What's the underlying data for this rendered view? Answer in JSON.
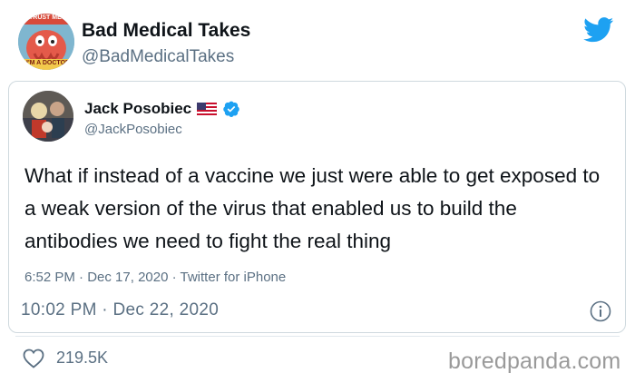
{
  "outer_tweet": {
    "avatar_text_top": "TRUST ME",
    "avatar_text_bottom": "I'M A DOCTOR",
    "name": "Bad Medical Takes",
    "handle": "@BadMedicalTakes",
    "date": "10:02 PM · Dec 22, 2020",
    "likes": "219.5K"
  },
  "quoted_tweet": {
    "name": "Jack Posobiec",
    "handle": "@JackPosobiec",
    "text": "What if instead of a vaccine we just were able to get exposed to a weak version of the virus that enabled us to build the antibodies we need to fight the real thing",
    "time": "6:52 PM",
    "date": "Dec 17, 2020",
    "source": "Twitter for iPhone",
    "separator": " · "
  },
  "icons": {
    "brand": "twitter-bird-icon",
    "verified": "verified-badge-icon",
    "flag": "us-flag-icon",
    "info": "info-icon",
    "like": "heart-icon"
  },
  "colors": {
    "twitter_blue": "#1da1f2",
    "secondary_text": "#5b7083",
    "primary_text": "#0f1419"
  },
  "watermark": "boredpanda.com"
}
